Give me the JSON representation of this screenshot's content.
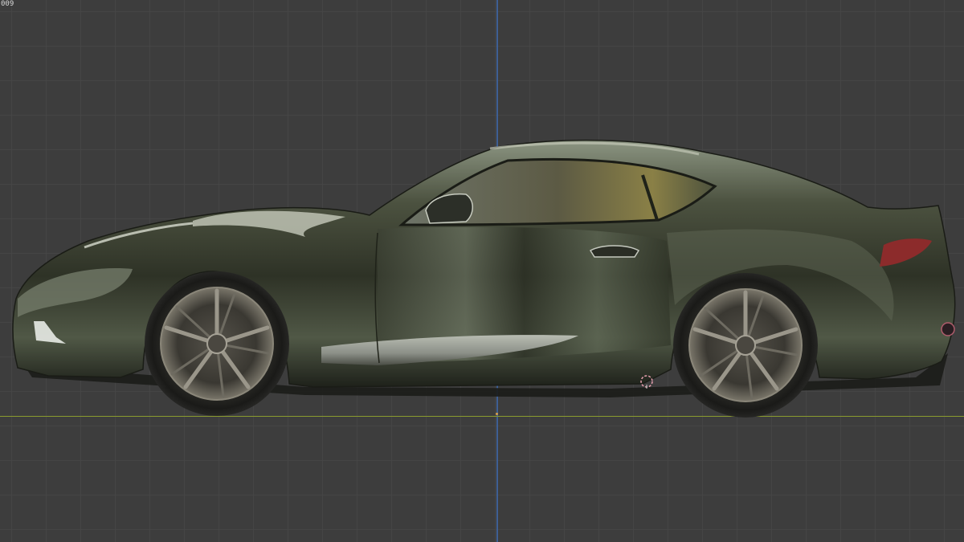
{
  "viewport": {
    "corner_label": "009",
    "background_color": "#3d3d3d",
    "grid_color": "#474747",
    "axis_z_color": "#3e5f94",
    "axis_y_color": "#8a9a2f"
  },
  "model": {
    "icon": "sports-car-side-view",
    "body_color": "#3a3f2f"
  },
  "cursor": {
    "icon": "3d-cursor-icon",
    "color": "#e8a0b0"
  }
}
